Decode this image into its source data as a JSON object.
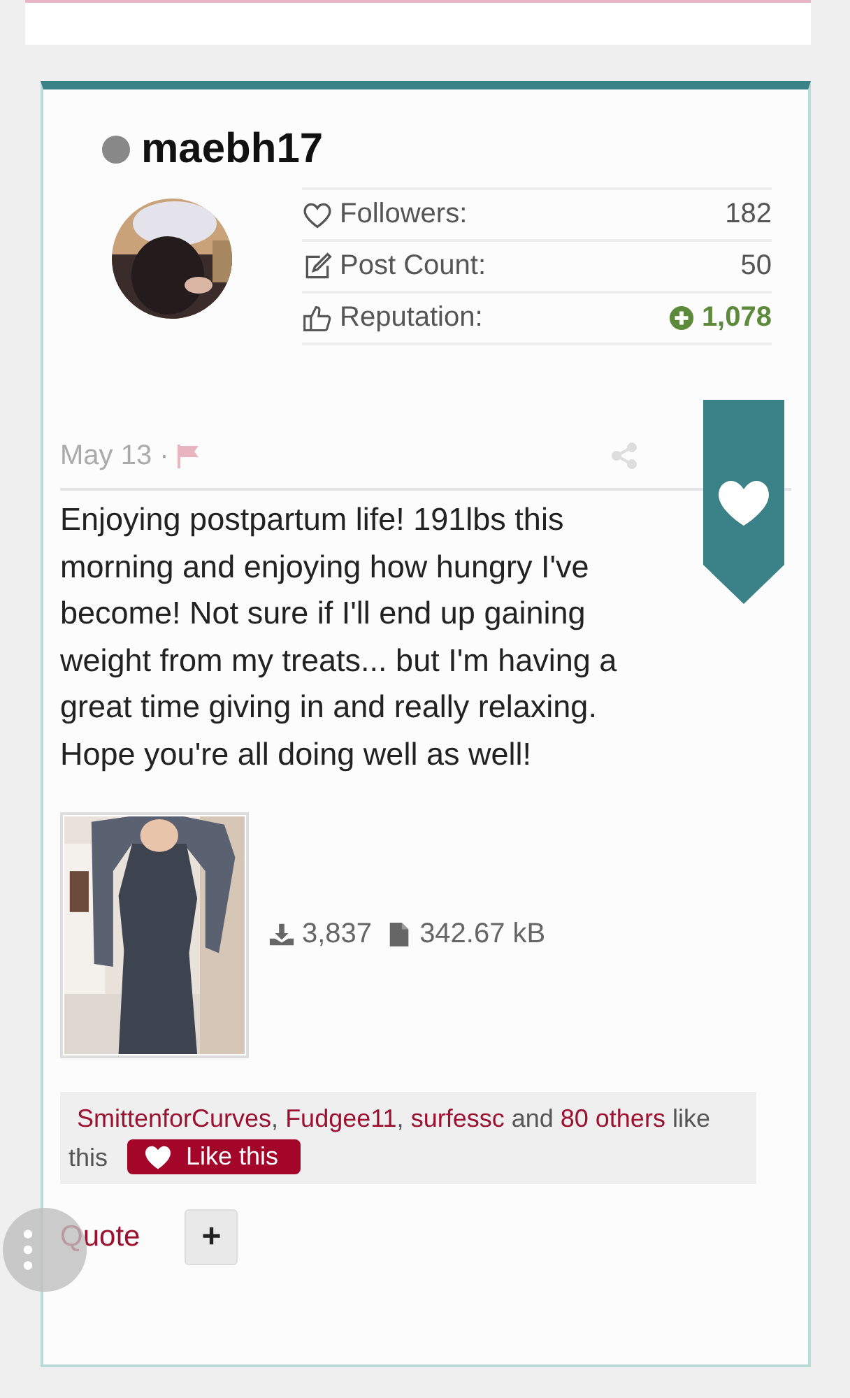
{
  "user": {
    "name": "maebh17",
    "online": false,
    "stats": [
      {
        "kind": "followers",
        "label": "Followers:",
        "value": "182"
      },
      {
        "kind": "posts",
        "label": "Post Count:",
        "value": "50"
      },
      {
        "kind": "reputation",
        "label": "Reputation:",
        "value": "1,078",
        "positive": true
      }
    ]
  },
  "post": {
    "date": "May 13",
    "separator": "·",
    "body": "Enjoying postpartum life! 191lbs this morning and enjoying how hungry I've become! Not sure if I'll end up gaining weight from my treats... but I'm having a great time giving in and really relaxing. Hope you're all doing well as well!",
    "attachment": {
      "kind": "picture",
      "downloads": "3,837",
      "size": "342.67 kB"
    },
    "likes": {
      "users": [
        {
          "name": "SmittenforCurves",
          "after": ","
        },
        {
          "name": "Fudgee11",
          "after": ","
        },
        {
          "name": "surfessc",
          "after": "and"
        }
      ],
      "others": "80 others",
      "suffix": "like"
    },
    "likes_tail": "this",
    "like_button": "Like this",
    "quote": "Quote",
    "more": "+"
  }
}
